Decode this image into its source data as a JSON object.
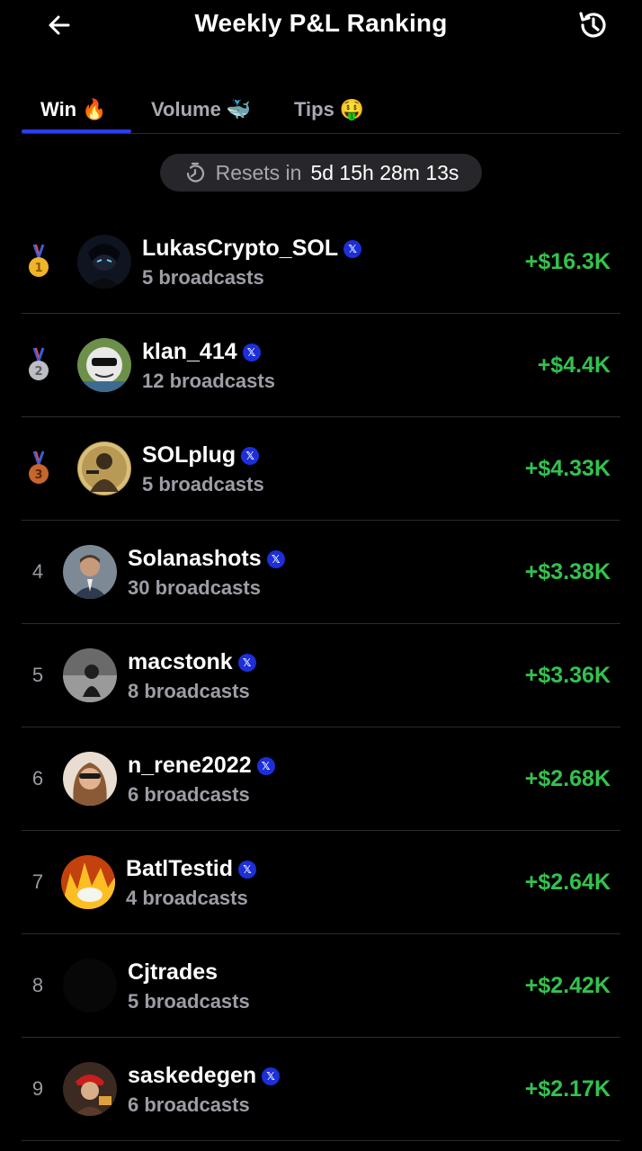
{
  "header": {
    "title": "Weekly P&L Ranking",
    "back_icon": "arrow-left-icon",
    "history_icon": "history-clock-icon"
  },
  "tabs": [
    {
      "label": "Win",
      "emoji": "🔥",
      "active": true
    },
    {
      "label": "Volume",
      "emoji": "🐳",
      "active": false
    },
    {
      "label": "Tips",
      "emoji": "🤑",
      "active": false
    }
  ],
  "reset": {
    "label": "Resets in",
    "time": "5d 15h 28m 13s",
    "icon": "timer-icon"
  },
  "colors": {
    "accent": "#2b3df2",
    "profit": "#33c24d",
    "gold": "#f0b429",
    "silver": "#bdbdc4",
    "bronze": "#c5662e"
  },
  "rows": [
    {
      "rank": "1",
      "medal": "gold",
      "name": "LukasCrypto_SOL",
      "verified": true,
      "broadcasts": "5 broadcasts",
      "pnl": "+$16.3K"
    },
    {
      "rank": "2",
      "medal": "silver",
      "name": "klan_414",
      "verified": true,
      "broadcasts": "12 broadcasts",
      "pnl": "+$4.4K"
    },
    {
      "rank": "3",
      "medal": "bronze",
      "name": "SOLplug",
      "verified": true,
      "broadcasts": "5 broadcasts",
      "pnl": "+$4.33K"
    },
    {
      "rank": "4",
      "medal": null,
      "name": "Solanashots",
      "verified": true,
      "broadcasts": "30 broadcasts",
      "pnl": "+$3.38K"
    },
    {
      "rank": "5",
      "medal": null,
      "name": "macstonk",
      "verified": true,
      "broadcasts": "8 broadcasts",
      "pnl": "+$3.36K"
    },
    {
      "rank": "6",
      "medal": null,
      "name": "n_rene2022",
      "verified": true,
      "broadcasts": "6 broadcasts",
      "pnl": "+$2.68K"
    },
    {
      "rank": "7",
      "medal": null,
      "name": "BatlTestid",
      "verified": true,
      "broadcasts": "4 broadcasts",
      "pnl": "+$2.64K"
    },
    {
      "rank": "8",
      "medal": null,
      "name": "Cjtrades",
      "verified": false,
      "broadcasts": "5 broadcasts",
      "pnl": "+$2.42K"
    },
    {
      "rank": "9",
      "medal": null,
      "name": "saskedegen",
      "verified": true,
      "broadcasts": "6 broadcasts",
      "pnl": "+$2.17K"
    }
  ]
}
